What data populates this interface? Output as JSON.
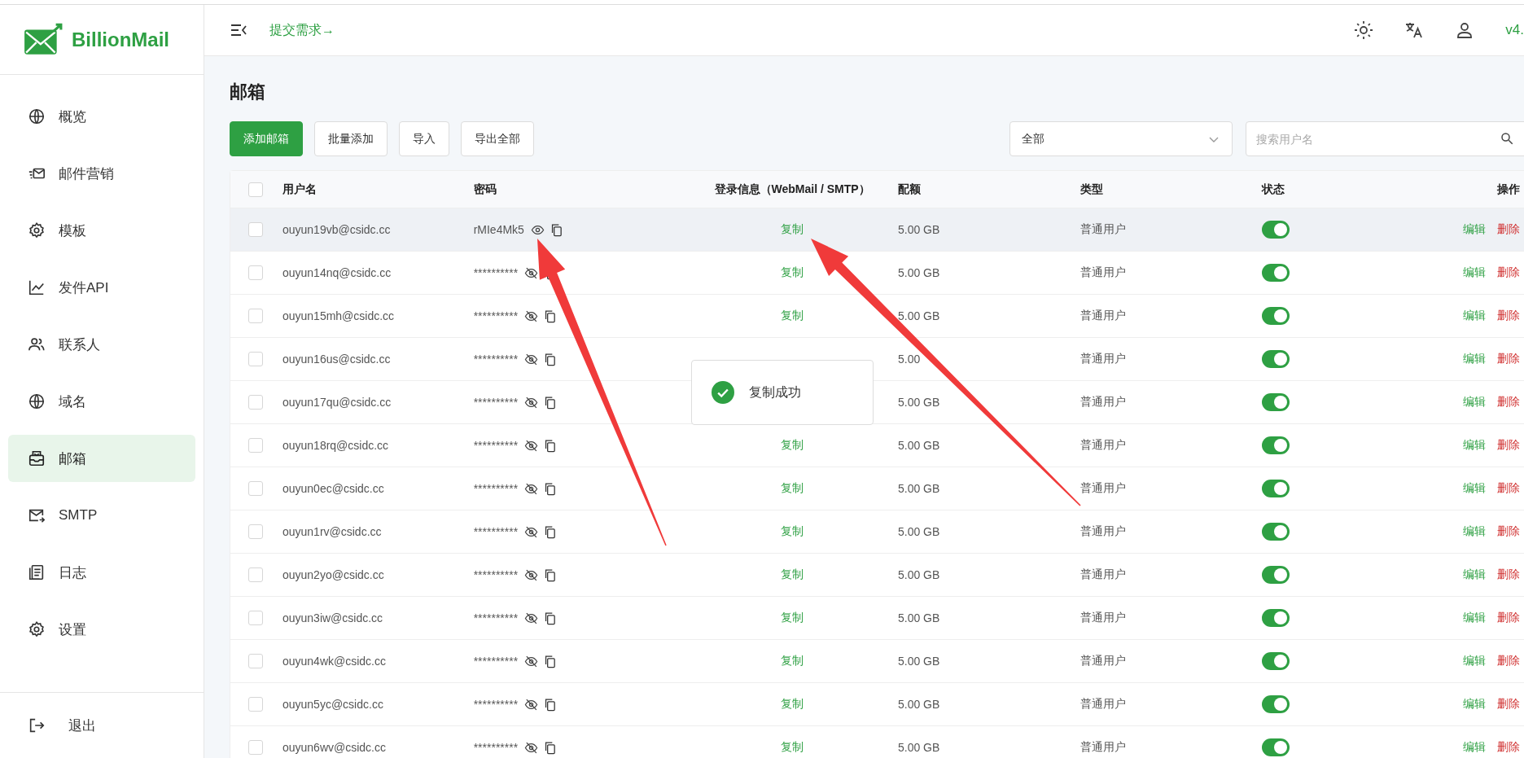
{
  "logo": {
    "text": "BillionMail"
  },
  "header": {
    "link": "提交需求→",
    "version": "v4."
  },
  "sidebar": {
    "items": [
      {
        "label": "概览",
        "kind": "globe",
        "selected": false
      },
      {
        "label": "邮件营销",
        "kind": "send",
        "selected": false
      },
      {
        "label": "模板",
        "kind": "gear",
        "selected": false
      },
      {
        "label": "发件API",
        "kind": "chart",
        "selected": false
      },
      {
        "label": "联系人",
        "kind": "users",
        "selected": false
      },
      {
        "label": "域名",
        "kind": "globe",
        "selected": false
      },
      {
        "label": "邮箱",
        "kind": "mailbox",
        "selected": true
      },
      {
        "label": "SMTP",
        "kind": "mailout",
        "selected": false
      },
      {
        "label": "日志",
        "kind": "doc",
        "selected": false
      },
      {
        "label": "设置",
        "kind": "gear",
        "selected": false
      }
    ],
    "logout": "退出"
  },
  "page_title": "邮箱",
  "toolbar": {
    "buttons": [
      {
        "label": "添加邮箱",
        "kind": "primary"
      },
      {
        "label": "批量添加",
        "kind": "default"
      },
      {
        "label": "导入",
        "kind": "default"
      },
      {
        "label": "导出全部",
        "kind": "default"
      }
    ],
    "filter": {
      "value": "全部"
    },
    "search": {
      "placeholder": "搜索用户名"
    }
  },
  "table": {
    "header_checked": false,
    "columns": [
      "用户名",
      "密码",
      "登录信息（WebMail / SMTP）",
      "配额",
      "类型",
      "状态",
      "操作"
    ],
    "rows": [
      {
        "checked": false,
        "highlighted": true,
        "username": "ouyun19vb@csidc.cc",
        "password": "rMIe4Mk5",
        "revealed": true,
        "login_info": "复制",
        "quota": "5.00 GB",
        "type": "普通用户",
        "enabled": true,
        "actions": [
          {
            "label": "编辑",
            "kind": "edit"
          },
          {
            "label": "删除",
            "kind": "delete"
          }
        ]
      },
      {
        "checked": false,
        "highlighted": false,
        "username": "ouyun14nq@csidc.cc",
        "password": "**********",
        "revealed": false,
        "login_info": "复制",
        "quota": "5.00 GB",
        "type": "普通用户",
        "enabled": true,
        "actions": [
          {
            "label": "编辑",
            "kind": "edit"
          },
          {
            "label": "删除",
            "kind": "delete"
          }
        ]
      },
      {
        "checked": false,
        "highlighted": false,
        "username": "ouyun15mh@csidc.cc",
        "password": "**********",
        "revealed": false,
        "login_info": "复制",
        "quota": "5.00 GB",
        "type": "普通用户",
        "enabled": true,
        "actions": [
          {
            "label": "编辑",
            "kind": "edit"
          },
          {
            "label": "删除",
            "kind": "delete"
          }
        ]
      },
      {
        "checked": false,
        "highlighted": false,
        "username": "ouyun16us@csidc.cc",
        "password": "**********",
        "revealed": false,
        "quota": "5.00",
        "type": "普通用户",
        "enabled": true,
        "actions": [
          {
            "label": "编辑",
            "kind": "edit"
          },
          {
            "label": "删除",
            "kind": "delete"
          }
        ]
      },
      {
        "checked": false,
        "highlighted": false,
        "username": "ouyun17qu@csidc.cc",
        "password": "**********",
        "revealed": false,
        "quota": "5.00 GB",
        "type": "普通用户",
        "enabled": true,
        "actions": [
          {
            "label": "编辑",
            "kind": "edit"
          },
          {
            "label": "删除",
            "kind": "delete"
          }
        ]
      },
      {
        "checked": false,
        "highlighted": false,
        "username": "ouyun18rq@csidc.cc",
        "password": "**********",
        "revealed": false,
        "login_info": "复制",
        "quota": "5.00 GB",
        "type": "普通用户",
        "enabled": true,
        "actions": [
          {
            "label": "编辑",
            "kind": "edit"
          },
          {
            "label": "删除",
            "kind": "delete"
          }
        ]
      },
      {
        "checked": false,
        "highlighted": false,
        "username": "ouyun0ec@csidc.cc",
        "password": "**********",
        "revealed": false,
        "login_info": "复制",
        "quota": "5.00 GB",
        "type": "普通用户",
        "enabled": true,
        "actions": [
          {
            "label": "编辑",
            "kind": "edit"
          },
          {
            "label": "删除",
            "kind": "delete"
          }
        ]
      },
      {
        "checked": false,
        "highlighted": false,
        "username": "ouyun1rv@csidc.cc",
        "password": "**********",
        "revealed": false,
        "login_info": "复制",
        "quota": "5.00 GB",
        "type": "普通用户",
        "enabled": true,
        "actions": [
          {
            "label": "编辑",
            "kind": "edit"
          },
          {
            "label": "删除",
            "kind": "delete"
          }
        ]
      },
      {
        "checked": false,
        "highlighted": false,
        "username": "ouyun2yo@csidc.cc",
        "password": "**********",
        "revealed": false,
        "login_info": "复制",
        "quota": "5.00 GB",
        "type": "普通用户",
        "enabled": true,
        "actions": [
          {
            "label": "编辑",
            "kind": "edit"
          },
          {
            "label": "删除",
            "kind": "delete"
          }
        ]
      },
      {
        "checked": false,
        "highlighted": false,
        "username": "ouyun3iw@csidc.cc",
        "password": "**********",
        "revealed": false,
        "login_info": "复制",
        "quota": "5.00 GB",
        "type": "普通用户",
        "enabled": true,
        "actions": [
          {
            "label": "编辑",
            "kind": "edit"
          },
          {
            "label": "删除",
            "kind": "delete"
          }
        ]
      },
      {
        "checked": false,
        "highlighted": false,
        "username": "ouyun4wk@csidc.cc",
        "password": "**********",
        "revealed": false,
        "login_info": "复制",
        "quota": "5.00 GB",
        "type": "普通用户",
        "enabled": true,
        "actions": [
          {
            "label": "编辑",
            "kind": "edit"
          },
          {
            "label": "删除",
            "kind": "delete"
          }
        ]
      },
      {
        "checked": false,
        "highlighted": false,
        "username": "ouyun5yc@csidc.cc",
        "password": "**********",
        "revealed": false,
        "login_info": "复制",
        "quota": "5.00 GB",
        "type": "普通用户",
        "enabled": true,
        "actions": [
          {
            "label": "编辑",
            "kind": "edit"
          },
          {
            "label": "删除",
            "kind": "delete"
          }
        ]
      },
      {
        "checked": false,
        "highlighted": false,
        "username": "ouyun6wv@csidc.cc",
        "password": "**********",
        "revealed": false,
        "login_info": "复制",
        "quota": "5.00 GB",
        "type": "普通用户",
        "enabled": true,
        "actions": [
          {
            "label": "编辑",
            "kind": "edit"
          },
          {
            "label": "删除",
            "kind": "delete"
          }
        ]
      }
    ]
  },
  "toast": {
    "message": "复制成功"
  }
}
